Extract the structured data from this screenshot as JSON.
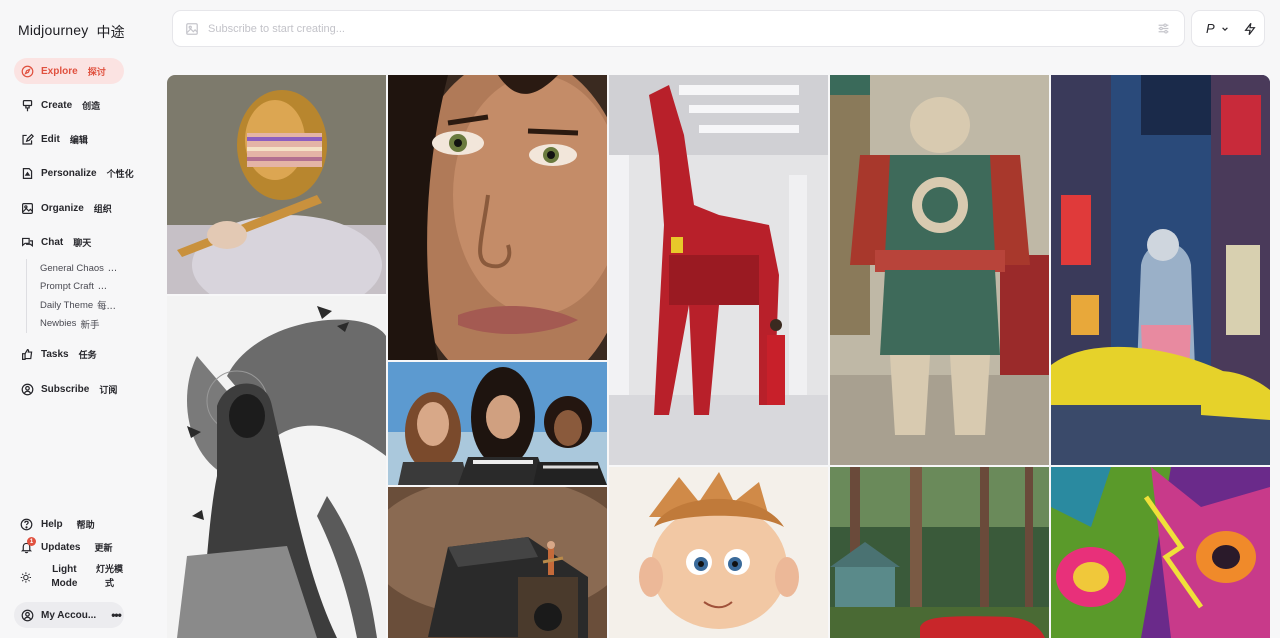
{
  "brand": {
    "name": "Midjourney",
    "name_cn": "中途"
  },
  "nav": {
    "explore": {
      "label": "Explore",
      "label_cn": "探讨"
    },
    "create": {
      "label": "Create",
      "label_cn": "创造"
    },
    "edit": {
      "label": "Edit",
      "label_cn": "编辑"
    },
    "personalize": {
      "label": "Personalize",
      "label_cn": "个性化"
    },
    "organize": {
      "label": "Organize",
      "label_cn": "组织"
    },
    "chat": {
      "label": "Chat",
      "label_cn": "聊天"
    },
    "tasks": {
      "label": "Tasks",
      "label_cn": "任务"
    },
    "subscribe": {
      "label": "Subscribe",
      "label_cn": "订阅"
    }
  },
  "chat_rooms": [
    {
      "label": "General Chaos",
      "label_cn": "..."
    },
    {
      "label": "Prompt Craft",
      "label_cn": "..."
    },
    {
      "label": "Daily Theme",
      "label_cn": "每..."
    },
    {
      "label": "Newbies",
      "label_cn": "新手"
    }
  ],
  "bottom": {
    "help": {
      "label": "Help",
      "label_cn": "帮助"
    },
    "updates": {
      "label": "Updates",
      "label_cn": "更新",
      "badge": "1"
    },
    "mode": {
      "label": "Light Mode",
      "label_cn": "灯光模式"
    },
    "account": {
      "label": "My Accou...",
      "more": "•••"
    }
  },
  "search": {
    "placeholder": "Subscribe to start creating..."
  },
  "profile_button": {
    "label": "P"
  },
  "colors": {
    "accent": "#e0513f",
    "active_bg": "#fbe3e2",
    "background": "#f7f7f8"
  },
  "gallery_images": [
    "daft-punk-style-flute-player",
    "freckled-woman-closeup",
    "red-ferrari-horse-sculpture",
    "samurai-armor-warrior",
    "cyberpunk-anime-city",
    "hooded-figure-with-angel-wings-engraving",
    "three-women-portrait",
    "miniature-guitarist-on-sneaker",
    "cartoon-boy-watercolor",
    "forest-house-with-red-car",
    "neon-monster-face"
  ]
}
